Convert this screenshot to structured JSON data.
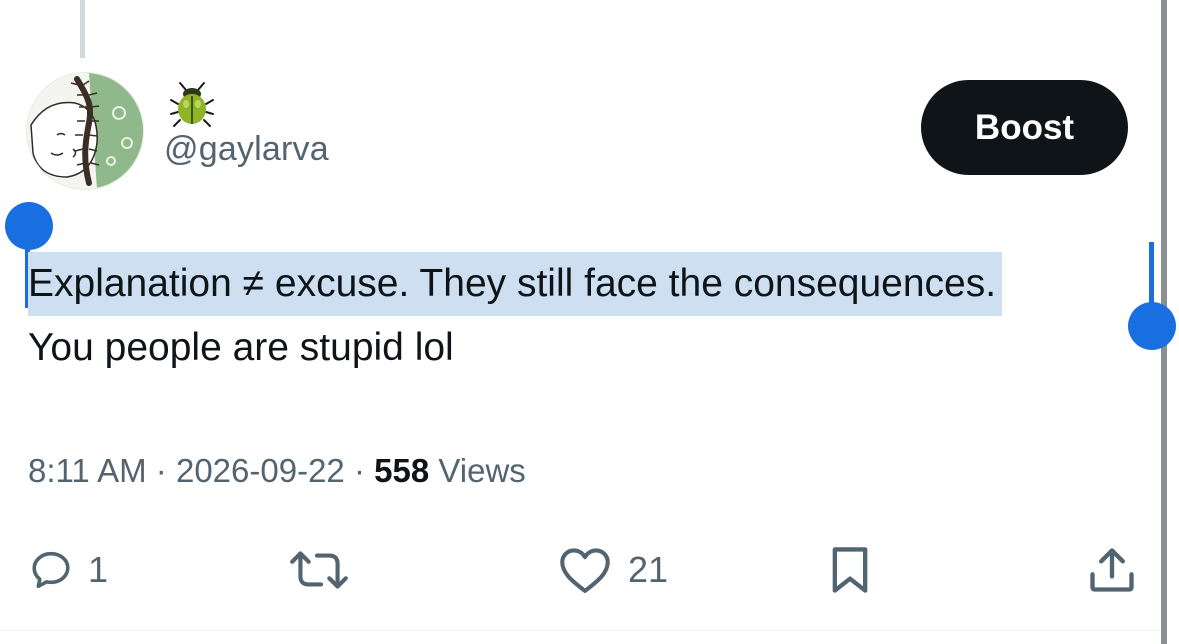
{
  "author": {
    "display_name_icon": "beetle-emoji",
    "handle": "@gaylarva"
  },
  "boost_button": {
    "label": "Boost"
  },
  "tweet": {
    "line1": "Explanation ≠ excuse. They still face the consequences.",
    "line2": "You people are stupid lol"
  },
  "meta": {
    "time": "8:11 AM",
    "separator": " · ",
    "date": "2026-09-22",
    "views_count": "558",
    "views_label": " Views"
  },
  "actions": {
    "reply": {
      "icon": "reply-icon",
      "count": "1"
    },
    "repost": {
      "icon": "repost-icon",
      "count": ""
    },
    "like": {
      "icon": "heart-icon",
      "count": "21"
    },
    "bookmark": {
      "icon": "bookmark-icon"
    },
    "share": {
      "icon": "share-icon"
    }
  },
  "colors": {
    "selection_highlight": "#cddff0",
    "selection_handle": "#1a6fe0",
    "button_bg": "#0f1419",
    "muted_text": "#536471"
  }
}
